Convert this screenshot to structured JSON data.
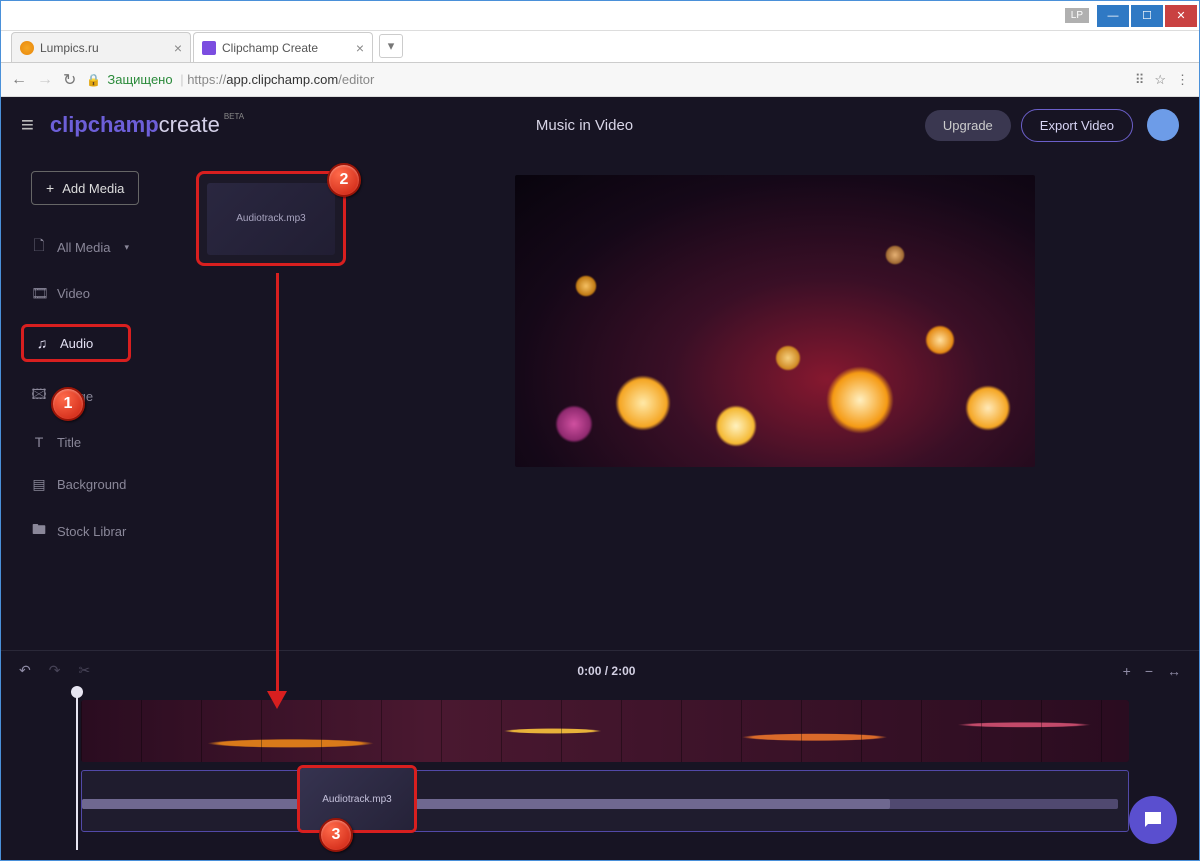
{
  "window": {
    "lp_badge": "LP"
  },
  "tabs": [
    {
      "title": "Lumpics.ru"
    },
    {
      "title": "Clipchamp Create"
    }
  ],
  "addressbar": {
    "secure_label": "Защищено",
    "protocol": "https://",
    "host": "app.clipchamp.com",
    "path": "/editor"
  },
  "header": {
    "logo_a": "clipchamp",
    "logo_b": "create",
    "beta": "BETA",
    "project_title": "Music in Video",
    "upgrade": "Upgrade",
    "export": "Export Video"
  },
  "side": {
    "add_media": "Add Media",
    "items": [
      {
        "label": "All Media",
        "icon": "🗋"
      },
      {
        "label": "Video",
        "icon": "🎞"
      },
      {
        "label": "Audio",
        "icon": "♫"
      },
      {
        "label": "Image",
        "icon": "🖾"
      },
      {
        "label": "Title",
        "icon": "T"
      },
      {
        "label": "Background",
        "icon": "▤"
      },
      {
        "label": "Stock Librar",
        "icon": "🖿"
      }
    ]
  },
  "media": {
    "audio_file": "Audiotrack.mp3"
  },
  "timeline": {
    "time": "0:00 / 2:00"
  },
  "badges": {
    "b1": "1",
    "b2": "2",
    "b3": "3"
  },
  "icons": {
    "minimize": "—",
    "maximize": "☐",
    "close": "✕",
    "plus": "+",
    "menu": "≡",
    "lock": "🔒",
    "back": "←",
    "forward": "→",
    "reload": "↻",
    "undo": "↶",
    "redo": "↷",
    "cut": "✂",
    "zoom_in": "+",
    "zoom_out": "−",
    "fit": "↔",
    "translate": "⠿",
    "dots": "⋮",
    "star": "☆",
    "chat": "💬",
    "close_tab": "×"
  }
}
